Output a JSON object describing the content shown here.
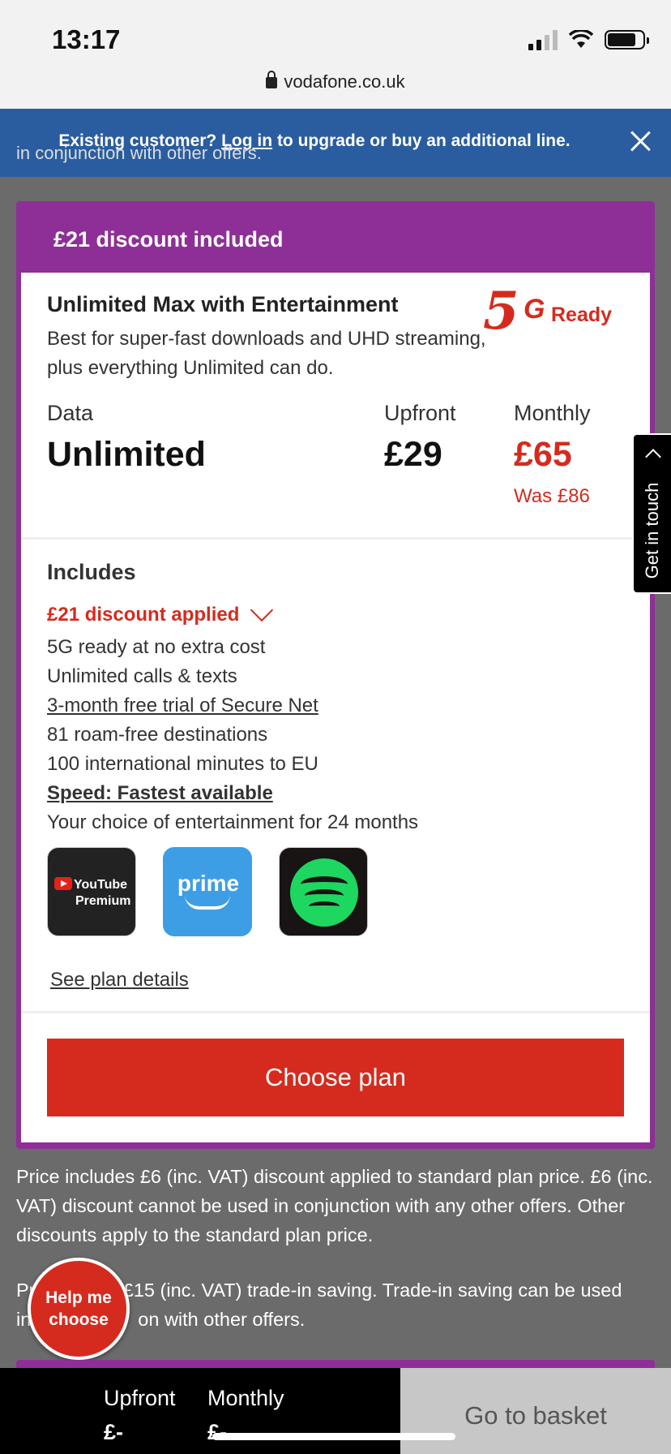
{
  "status_bar": {
    "time": "13:17",
    "url": "vodafone.co.uk"
  },
  "banner": {
    "prefix": "Existing customer?",
    "link": "Log in",
    "suffix": "to upgrade or buy an additional line."
  },
  "cut_text": "in conjunction with other offers.",
  "card": {
    "header": "£21 discount included",
    "plan_name": "Unlimited Max with Entertainment",
    "plan_description": "Best for super-fast downloads and UHD streaming, plus everything Unlimited can do.",
    "badge": {
      "five": "5",
      "g": "G",
      "ready": "Ready"
    },
    "data_label": "Data",
    "data_value": "Unlimited",
    "upfront_label": "Upfront",
    "upfront_value": "£29",
    "monthly_label": "Monthly",
    "monthly_value": "£65",
    "was_price": "Was £86",
    "includes_title": "Includes",
    "discount_applied": "£21 discount applied",
    "features": [
      "5G ready at no extra cost",
      "Unlimited calls & texts",
      "3-month free trial of Secure Net",
      "81 roam-free destinations",
      "100 international minutes to EU",
      "Speed: Fastest available"
    ],
    "entertainment_text": "Your choice of entertainment for 24 months",
    "tiles": {
      "youtube_line1": "YouTube",
      "youtube_line2": "Premium",
      "prime": "prime"
    },
    "see_details": "See plan details",
    "choose_button": "Choose plan"
  },
  "get_in_touch": "Get in touch",
  "footnotes": {
    "first": "Price includes £6 (inc. VAT) discount applied to standard plan price. £6 (inc. VAT) discount cannot be used in conjunction with any other offers. Other discounts apply to the standard plan price.",
    "second_visible_a": "Pr",
    "second_visible_b": "s £15 (inc. VAT) trade-in saving. Trade-in saving can be used",
    "second_line2_a": "in",
    "second_line2_b": "on with other offers."
  },
  "help_button": {
    "line1": "Help me",
    "line2": "choose"
  },
  "bottom_bar": {
    "upfront_label": "Upfront",
    "upfront_value": "£-",
    "monthly_label": "Monthly",
    "monthly_value": "£-",
    "basket_button": "Go to basket"
  },
  "colors": {
    "vodafone_red": "#d52b1e",
    "purple": "#8e2f97",
    "banner_blue": "#2a5d9f"
  }
}
